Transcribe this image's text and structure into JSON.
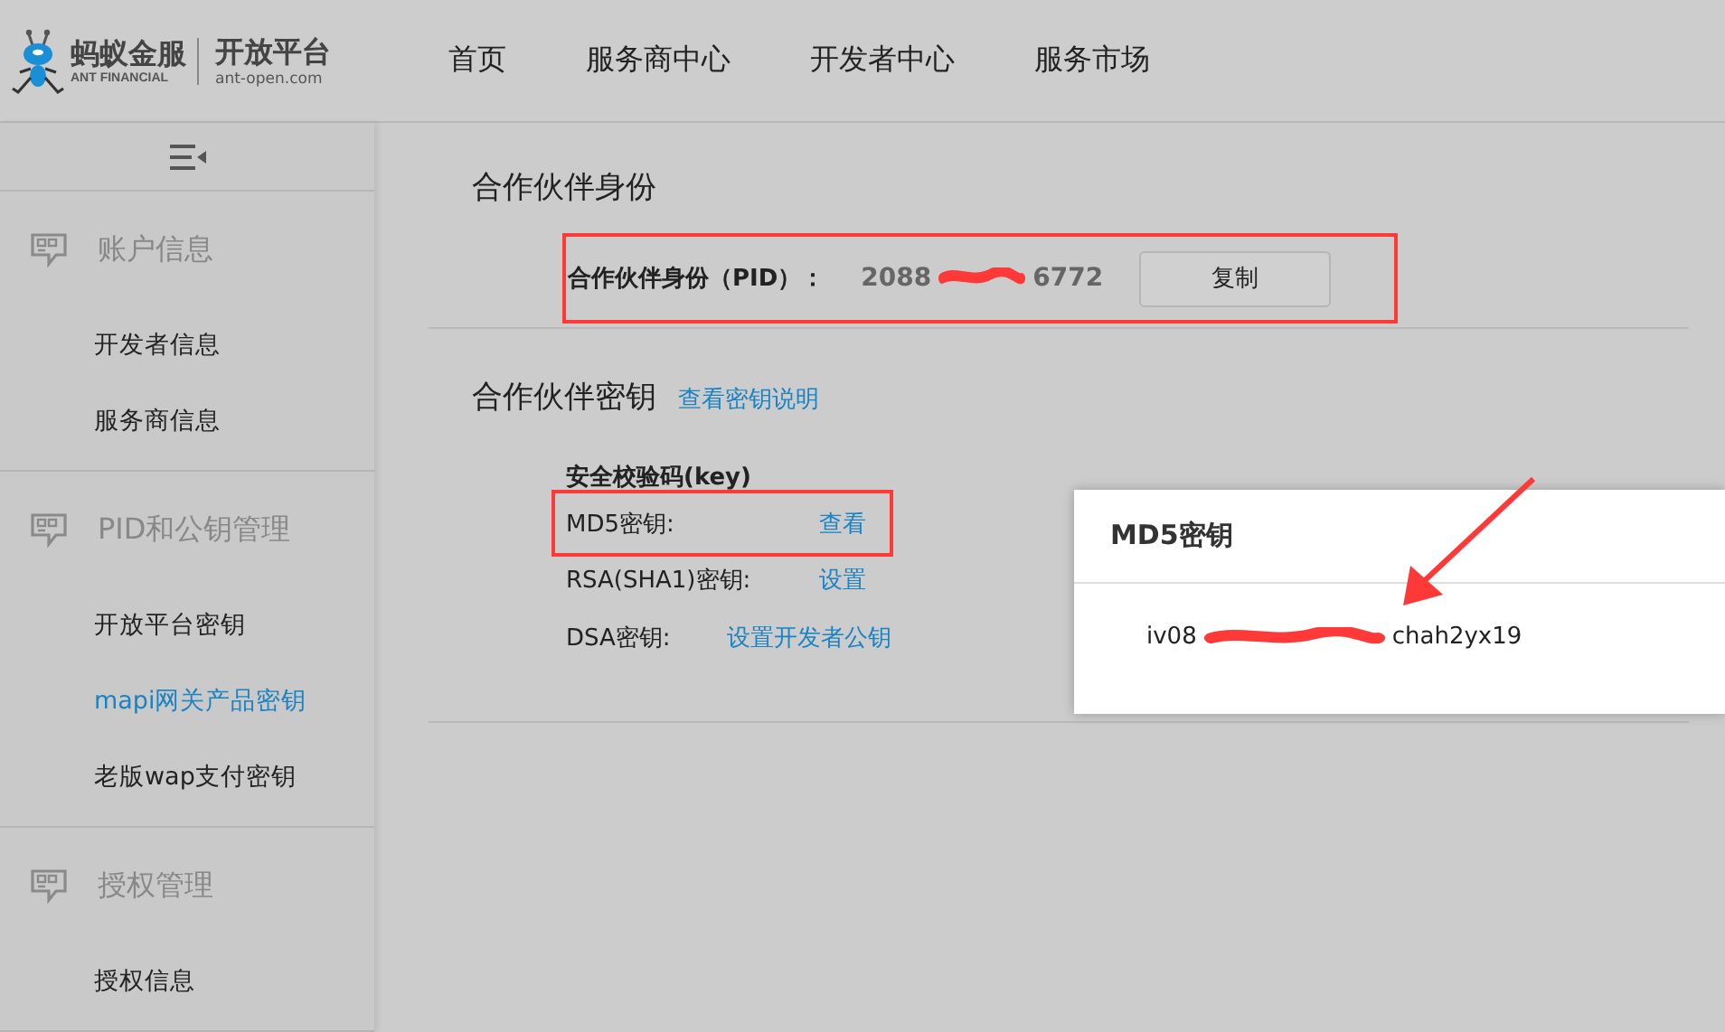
{
  "header": {
    "logo_name": "蚂蚁金服",
    "logo_sub": "ANT FINANCIAL",
    "platform": "开放平台",
    "platform_url": "ant-open.com",
    "nav": [
      {
        "label": "首页"
      },
      {
        "label": "服务商中心"
      },
      {
        "label": "开发者中心"
      },
      {
        "label": "服务市场"
      }
    ]
  },
  "sidebar": {
    "groups": [
      {
        "title": "账户信息",
        "items": [
          {
            "label": "开发者信息",
            "selected": false
          },
          {
            "label": "服务商信息",
            "selected": false
          }
        ]
      },
      {
        "title": "PID和公钥管理",
        "items": [
          {
            "label": "开放平台密钥",
            "selected": false
          },
          {
            "label": "mapi网关产品密钥",
            "selected": true
          },
          {
            "label": "老版wap支付密钥",
            "selected": false
          }
        ]
      },
      {
        "title": "授权管理",
        "items": [
          {
            "label": "授权信息",
            "selected": false
          }
        ]
      }
    ]
  },
  "identity": {
    "title": "合作伙伴身份",
    "pid_label": "合作伙伴身份（PID）：",
    "pid_start": "2088",
    "pid_end": "6772",
    "copy_button": "复制"
  },
  "keys": {
    "title": "合作伙伴密钥",
    "help_link": "查看密钥说明",
    "section_label": "安全校验码(key)",
    "rows": [
      {
        "label": "MD5密钥:",
        "action": "查看",
        "highlighted": true
      },
      {
        "label": "RSA(SHA1)密钥:",
        "action": "设置",
        "highlighted": false
      },
      {
        "label": "DSA密钥:",
        "action": "设置开发者公钥",
        "highlighted": false
      }
    ]
  },
  "popup": {
    "title": "MD5密钥",
    "key_start": "iv08",
    "key_end": "chah2yx19"
  }
}
